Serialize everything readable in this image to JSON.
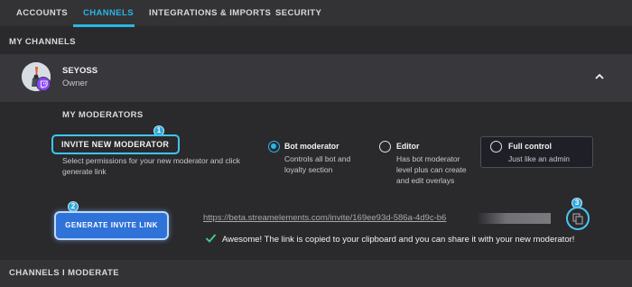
{
  "tabs": [
    {
      "label": "ACCOUNTS"
    },
    {
      "label": "CHANNELS"
    },
    {
      "label": "INTEGRATIONS & IMPORTS"
    },
    {
      "label": "SECURITY"
    }
  ],
  "my_channels": {
    "title": "MY CHANNELS",
    "channel": {
      "name": "SEYOSS",
      "role": "Owner"
    }
  },
  "moderators": {
    "title": "MY MODERATORS",
    "invite_title": "INVITE NEW MODERATOR",
    "invite_desc": "Select permissions for your new moderator and click generate link",
    "options": [
      {
        "title": "Bot moderator",
        "desc": "Controls all bot and loyalty section",
        "checked": true
      },
      {
        "title": "Editor",
        "desc": "Has bot moderator level plus can create and edit overlays",
        "checked": false
      },
      {
        "title": "Full control",
        "desc": "Just like an admin",
        "checked": false
      }
    ],
    "generate_label": "GENERATE INVITE LINK",
    "invite_link": "https://beta.streamelements.com/invite/169ee93d-586a-4d9c-b6",
    "success": "Awesome! The link is copied to your clipboard and you can share it with your new moderator!"
  },
  "steps": [
    "1",
    "2",
    "3"
  ],
  "channels_i_moderate": {
    "title": "CHANNELS I MODERATE"
  },
  "colors": {
    "accent": "#29b6e6",
    "button": "#2f72d8",
    "twitch": "#8a46ff",
    "success": "#3fd18a"
  },
  "icons": [
    "chevron-up-icon",
    "twitch-icon",
    "copy-icon",
    "checkmark-icon"
  ]
}
